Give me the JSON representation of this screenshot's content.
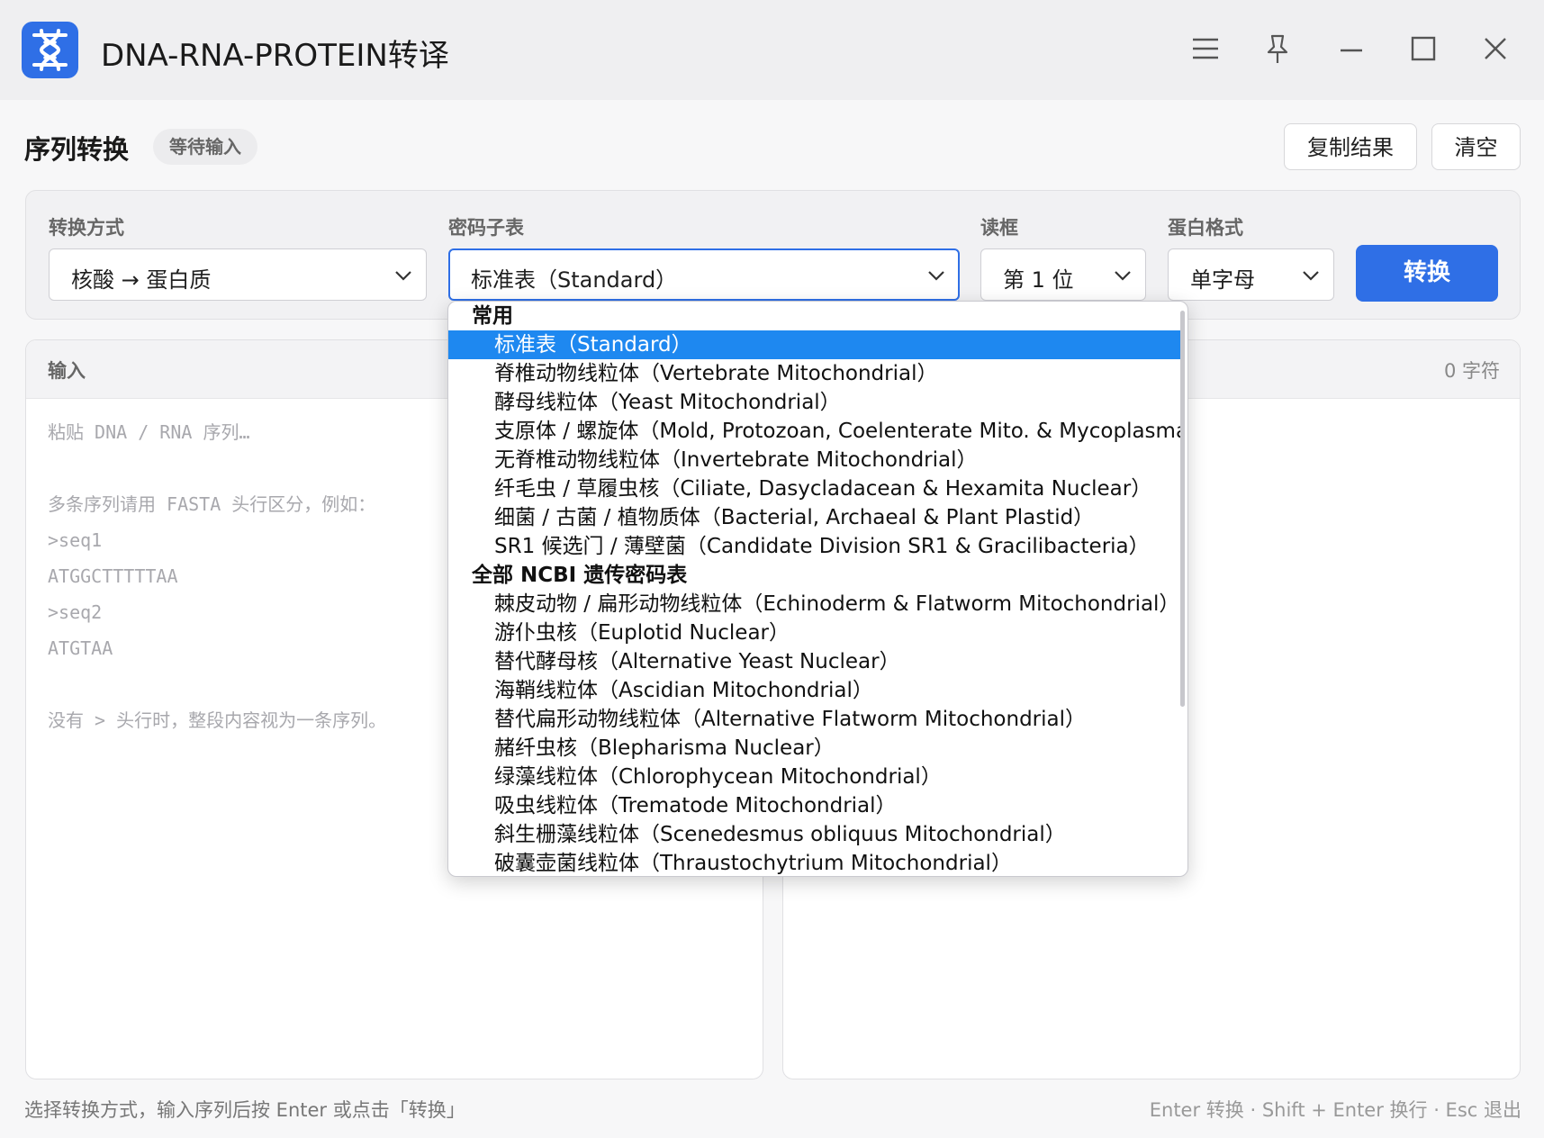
{
  "window": {
    "title": "DNA-RNA-PROTEIN转译",
    "icon": "dna-helix-icon"
  },
  "header": {
    "page_title": "序列转换",
    "status_badge": "等待输入",
    "copy_button": "复制结果",
    "clear_button": "清空"
  },
  "options": {
    "mode_label": "转换方式",
    "mode_value": "核酸 → 蛋白质",
    "codon_label": "密码子表",
    "codon_value": "标准表（Standard）",
    "frame_label": "读框",
    "frame_value": "第 1 位",
    "format_label": "蛋白格式",
    "format_value": "单字母",
    "convert_button": "转换"
  },
  "input": {
    "title": "输入",
    "char_count": "0 字符",
    "placeholder": "粘贴 DNA / RNA 序列…\n\n多条序列请用 FASTA 头行区分，例如：\n>seq1\nATGGCTTTTTAA\n>seq2\nATGTAA\n\n没有 > 头行时，整段内容视为一条序列。"
  },
  "dropdown": {
    "groups": [
      {
        "label": "常用",
        "items": [
          "标准表（Standard）",
          "脊椎动物线粒体（Vertebrate Mitochondrial）",
          "酵母线粒体（Yeast Mitochondrial）",
          "支原体 / 螺旋体（Mold, Protozoan, Coelenterate Mito. & Mycoplasma）",
          "无脊椎动物线粒体（Invertebrate Mitochondrial）",
          "纤毛虫 / 草履虫核（Ciliate, Dasycladacean & Hexamita Nuclear）",
          "细菌 / 古菌 / 植物质体（Bacterial, Archaeal & Plant Plastid）",
          "SR1 候选门 / 薄壁菌（Candidate Division SR1 & Gracilibacteria）"
        ]
      },
      {
        "label": "全部 NCBI 遗传密码表",
        "items": [
          "棘皮动物 / 扁形动物线粒体（Echinoderm & Flatworm Mitochondrial）",
          "游仆虫核（Euplotid Nuclear）",
          "替代酵母核（Alternative Yeast Nuclear）",
          "海鞘线粒体（Ascidian Mitochondrial）",
          "替代扁形动物线粒体（Alternative Flatworm Mitochondrial）",
          "赭纤虫核（Blepharisma Nuclear）",
          "绿藻线粒体（Chlorophycean Mitochondrial）",
          "吸虫线粒体（Trematode Mitochondrial）",
          "斜生栅藻线粒体（Scenedesmus obliquus Mitochondrial）",
          "破囊壶菌线粒体（Thraustochytrium Mitochondrial）"
        ]
      }
    ],
    "selected": "标准表（Standard）"
  },
  "footer": {
    "hint_left": "选择转换方式，输入序列后按 Enter 或点击「转换」",
    "hint_right": "Enter 转换 · Shift + Enter 换行 · Esc 退出"
  },
  "colors": {
    "accent": "#2f6fe6",
    "selected_item": "#1e88f0"
  }
}
